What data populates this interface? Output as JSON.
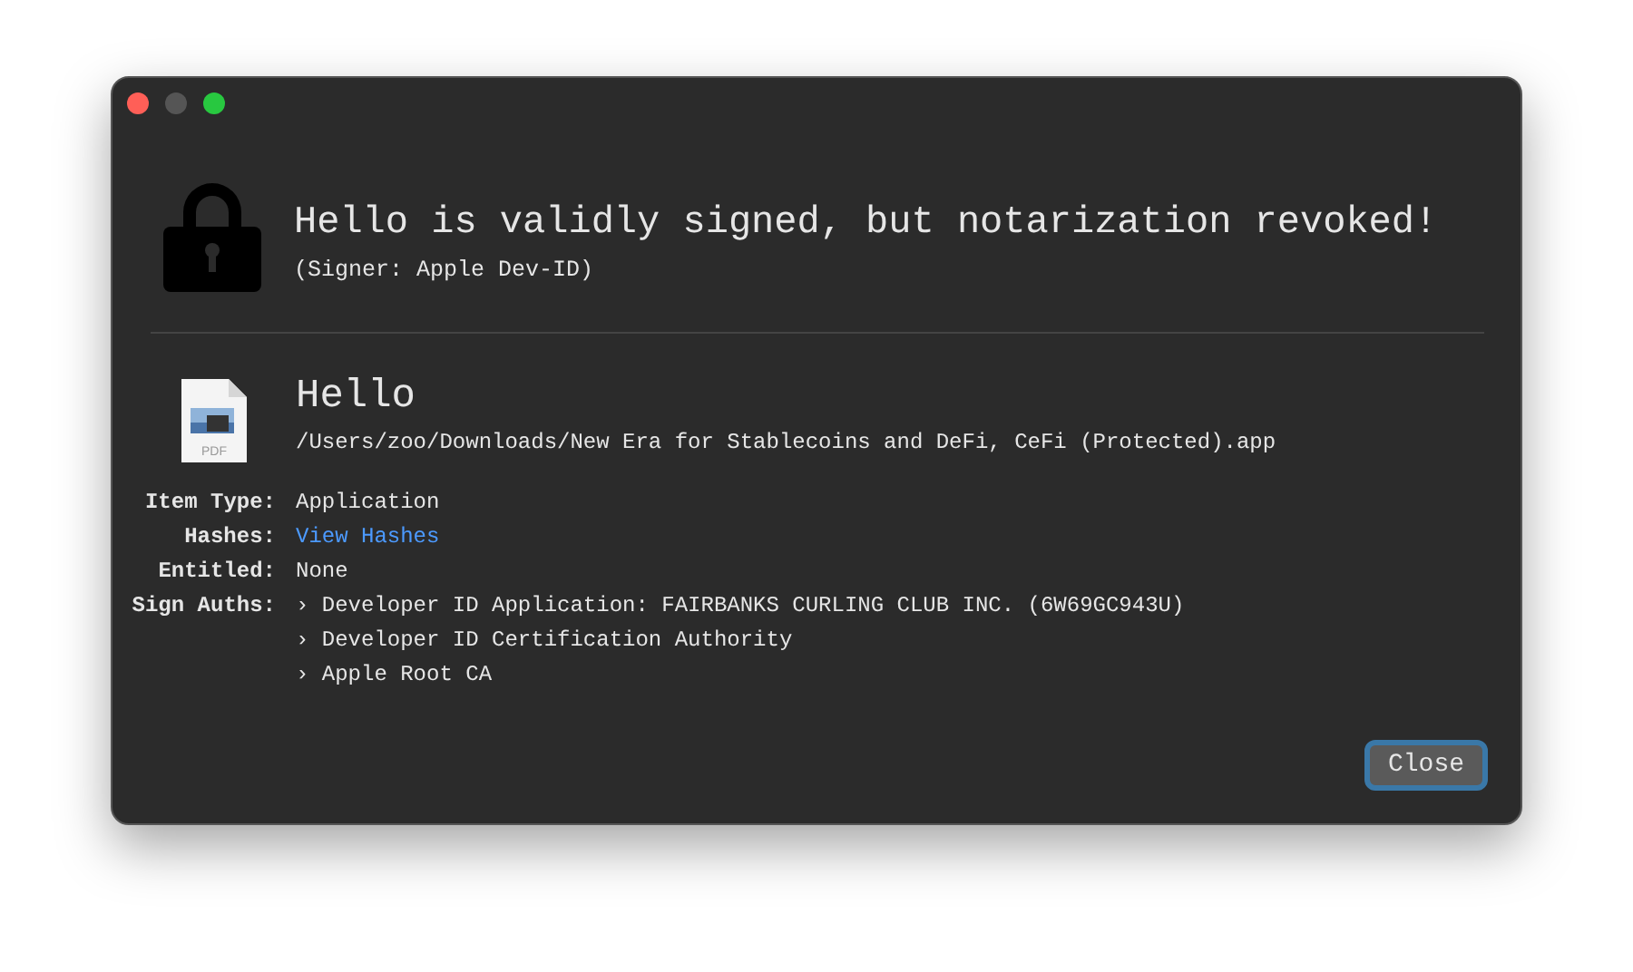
{
  "header": {
    "title": "Hello is validly signed, but notarization revoked!",
    "subtitle": "(Signer: Apple Dev-ID)"
  },
  "item": {
    "name": "Hello",
    "path": "/Users/zoo/Downloads/New Era for Stablecoins and DeFi, CeFi (Protected).app",
    "icon_label": "PDF"
  },
  "details": [
    {
      "kind": "text",
      "label": "Item Type:",
      "values": [
        "Application"
      ]
    },
    {
      "kind": "link",
      "label": "Hashes:",
      "values": [
        "View Hashes"
      ]
    },
    {
      "kind": "text",
      "label": "Entitled:",
      "values": [
        "None"
      ]
    },
    {
      "kind": "list",
      "label": "Sign Auths:",
      "values": [
        "› Developer ID Application: FAIRBANKS CURLING CLUB INC. (6W69GC943U)",
        "› Developer ID Certification Authority",
        "› Apple Root CA"
      ]
    }
  ],
  "buttons": [
    {
      "label": "Close"
    }
  ]
}
